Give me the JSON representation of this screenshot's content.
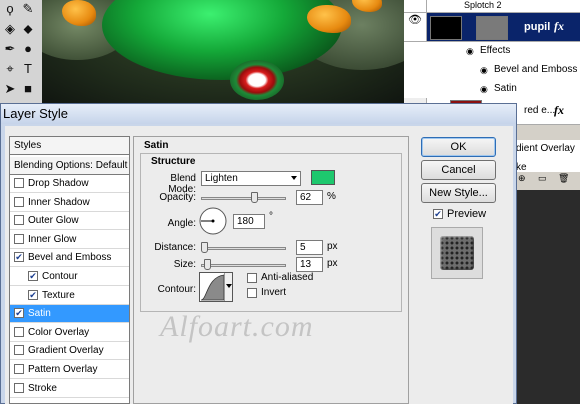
{
  "layers": {
    "items": [
      {
        "label": "Splotch 2"
      },
      {
        "label": "pupil"
      },
      {
        "label": "Effects"
      },
      {
        "label": "Bevel and Emboss"
      },
      {
        "label": "Satin"
      },
      {
        "label": "red e..."
      }
    ],
    "partial": {
      "gradient": "dient Overlay",
      "stroke": "ke"
    }
  },
  "dialog": {
    "title": "Layer Style",
    "styles": {
      "header": "Styles",
      "blending": "Blending Options: Default",
      "items": [
        {
          "label": "Drop Shadow",
          "checked": false
        },
        {
          "label": "Inner Shadow",
          "checked": false
        },
        {
          "label": "Outer Glow",
          "checked": false
        },
        {
          "label": "Inner Glow",
          "checked": false
        },
        {
          "label": "Bevel and Emboss",
          "checked": true
        },
        {
          "label": "Contour",
          "checked": true
        },
        {
          "label": "Texture",
          "checked": true
        },
        {
          "label": "Satin",
          "checked": true
        },
        {
          "label": "Color Overlay",
          "checked": false
        },
        {
          "label": "Gradient Overlay",
          "checked": false
        },
        {
          "label": "Pattern Overlay",
          "checked": false
        },
        {
          "label": "Stroke",
          "checked": false
        }
      ]
    },
    "satin": {
      "title": "Satin",
      "structure_title": "Structure",
      "blend_mode_label": "Blend Mode:",
      "blend_mode_value": "Lighten",
      "blend_color": "#1ec86e",
      "opacity_label": "Opacity:",
      "opacity_value": "62",
      "opacity_unit": "%",
      "angle_label": "Angle:",
      "angle_value": "180",
      "angle_unit": "°",
      "distance_label": "Distance:",
      "distance_value": "5",
      "distance_unit": "px",
      "size_label": "Size:",
      "size_value": "13",
      "size_unit": "px",
      "contour_label": "Contour:",
      "anti_aliased_label": "Anti-aliased",
      "invert_label": "Invert"
    },
    "buttons": {
      "ok": "OK",
      "cancel": "Cancel",
      "new_style": "New Style..."
    },
    "preview_label": "Preview",
    "preview_checked": true
  },
  "watermark": "Alfoart.com"
}
